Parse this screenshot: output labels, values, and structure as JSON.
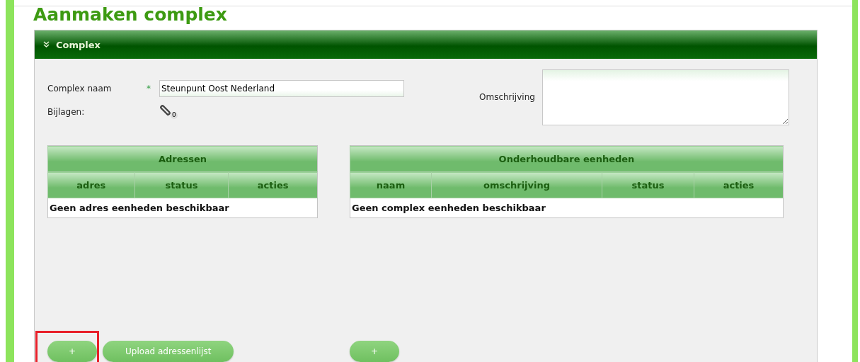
{
  "page_title": "Aanmaken complex",
  "panel": {
    "title": "Complex",
    "expanded": true
  },
  "form": {
    "name_label": "Complex naam",
    "name_required_mark": "*",
    "name_value": "Steunpunt Oost Nederland",
    "attachments_label": "Bijlagen:",
    "attachments_count": "0",
    "description_label": "Omschrijving"
  },
  "tables": [
    {
      "title": "Adressen",
      "columns": [
        "adres",
        "status",
        "acties"
      ],
      "empty_text": "Geen adres eenheden beschikbaar",
      "buttons": [
        {
          "label": "+",
          "highlighted": true
        },
        {
          "label": "Upload adressenlijst",
          "highlighted": false
        }
      ]
    },
    {
      "title": "Onderhoudbare eenheden",
      "columns": [
        "naam",
        "omschrijving",
        "status",
        "acties"
      ],
      "empty_text": "Geen complex eenheden beschikbaar",
      "buttons": [
        {
          "label": "+",
          "highlighted": false
        }
      ]
    }
  ]
}
